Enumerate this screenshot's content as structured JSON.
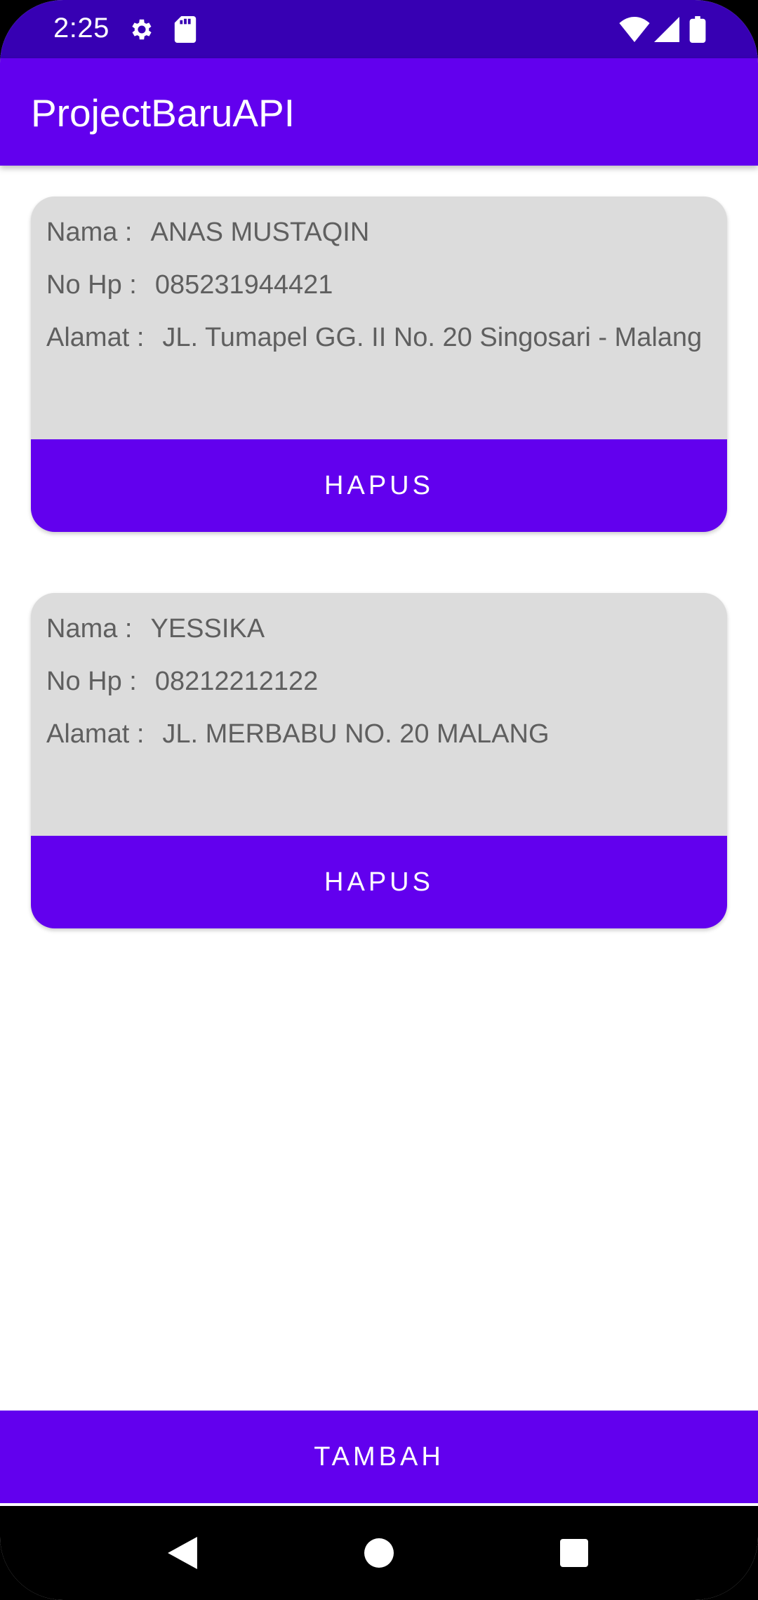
{
  "status_bar": {
    "time": "2:25",
    "icons": [
      "settings-icon",
      "sd-card-icon",
      "wifi-icon",
      "cell-signal-icon",
      "battery-icon"
    ]
  },
  "app_bar": {
    "title": "ProjectBaruAPI"
  },
  "contacts": [
    {
      "nama_label": "Nama :",
      "nama": "ANAS MUSTAQIN",
      "hp_label": "No Hp :",
      "hp": "085231944421",
      "alamat_label": "Alamat :",
      "alamat": "JL. Tumapel GG. II No. 20 Singosari - Malang",
      "delete_label": "HAPUS"
    },
    {
      "nama_label": "Nama :",
      "nama": "YESSIKA",
      "hp_label": "No Hp :",
      "hp": "08212212122",
      "alamat_label": "Alamat :",
      "alamat": "JL. MERBABU NO. 20 MALANG",
      "delete_label": "HAPUS"
    }
  ],
  "footer": {
    "add_label": "TAMBAH"
  },
  "nav_bar": {
    "icons": [
      "back-icon",
      "home-icon",
      "recents-icon"
    ]
  },
  "colors": {
    "primary": "#6200ee",
    "primary_dark": "#3700b3",
    "card_bg": "#dcdcdc",
    "text_secondary": "#5f5f5f"
  }
}
